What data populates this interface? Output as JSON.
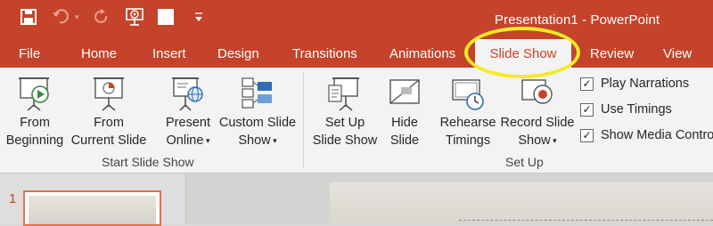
{
  "window": {
    "title": "Presentation1 - PowerPoint"
  },
  "tabs": [
    {
      "label": "File"
    },
    {
      "label": "Home"
    },
    {
      "label": "Insert"
    },
    {
      "label": "Design"
    },
    {
      "label": "Transitions"
    },
    {
      "label": "Animations"
    },
    {
      "label": "Slide Show"
    },
    {
      "label": "Review"
    },
    {
      "label": "View"
    }
  ],
  "ribbon": {
    "start_group": {
      "label": "Start Slide Show",
      "buttons": [
        {
          "line1": "From",
          "line2": "Beginning"
        },
        {
          "line1": "From",
          "line2": "Current Slide"
        },
        {
          "line1": "Present",
          "line2": "Online"
        },
        {
          "line1": "Custom Slide",
          "line2": "Show"
        }
      ]
    },
    "setup_group": {
      "label": "Set Up",
      "buttons": [
        {
          "line1": "Set Up",
          "line2": "Slide Show"
        },
        {
          "line1": "Hide",
          "line2": "Slide"
        },
        {
          "line1": "Rehearse",
          "line2": "Timings"
        },
        {
          "line1": "Record Slide",
          "line2": "Show"
        }
      ],
      "checkboxes": [
        {
          "label": "Play Narrations",
          "checked": true
        },
        {
          "label": "Use Timings",
          "checked": true
        },
        {
          "label": "Show Media Contro",
          "checked": true
        }
      ]
    }
  },
  "thumbnails": {
    "slide_number": "1"
  },
  "colors": {
    "accent": "#c4432a",
    "highlight": "#f5ea27"
  }
}
